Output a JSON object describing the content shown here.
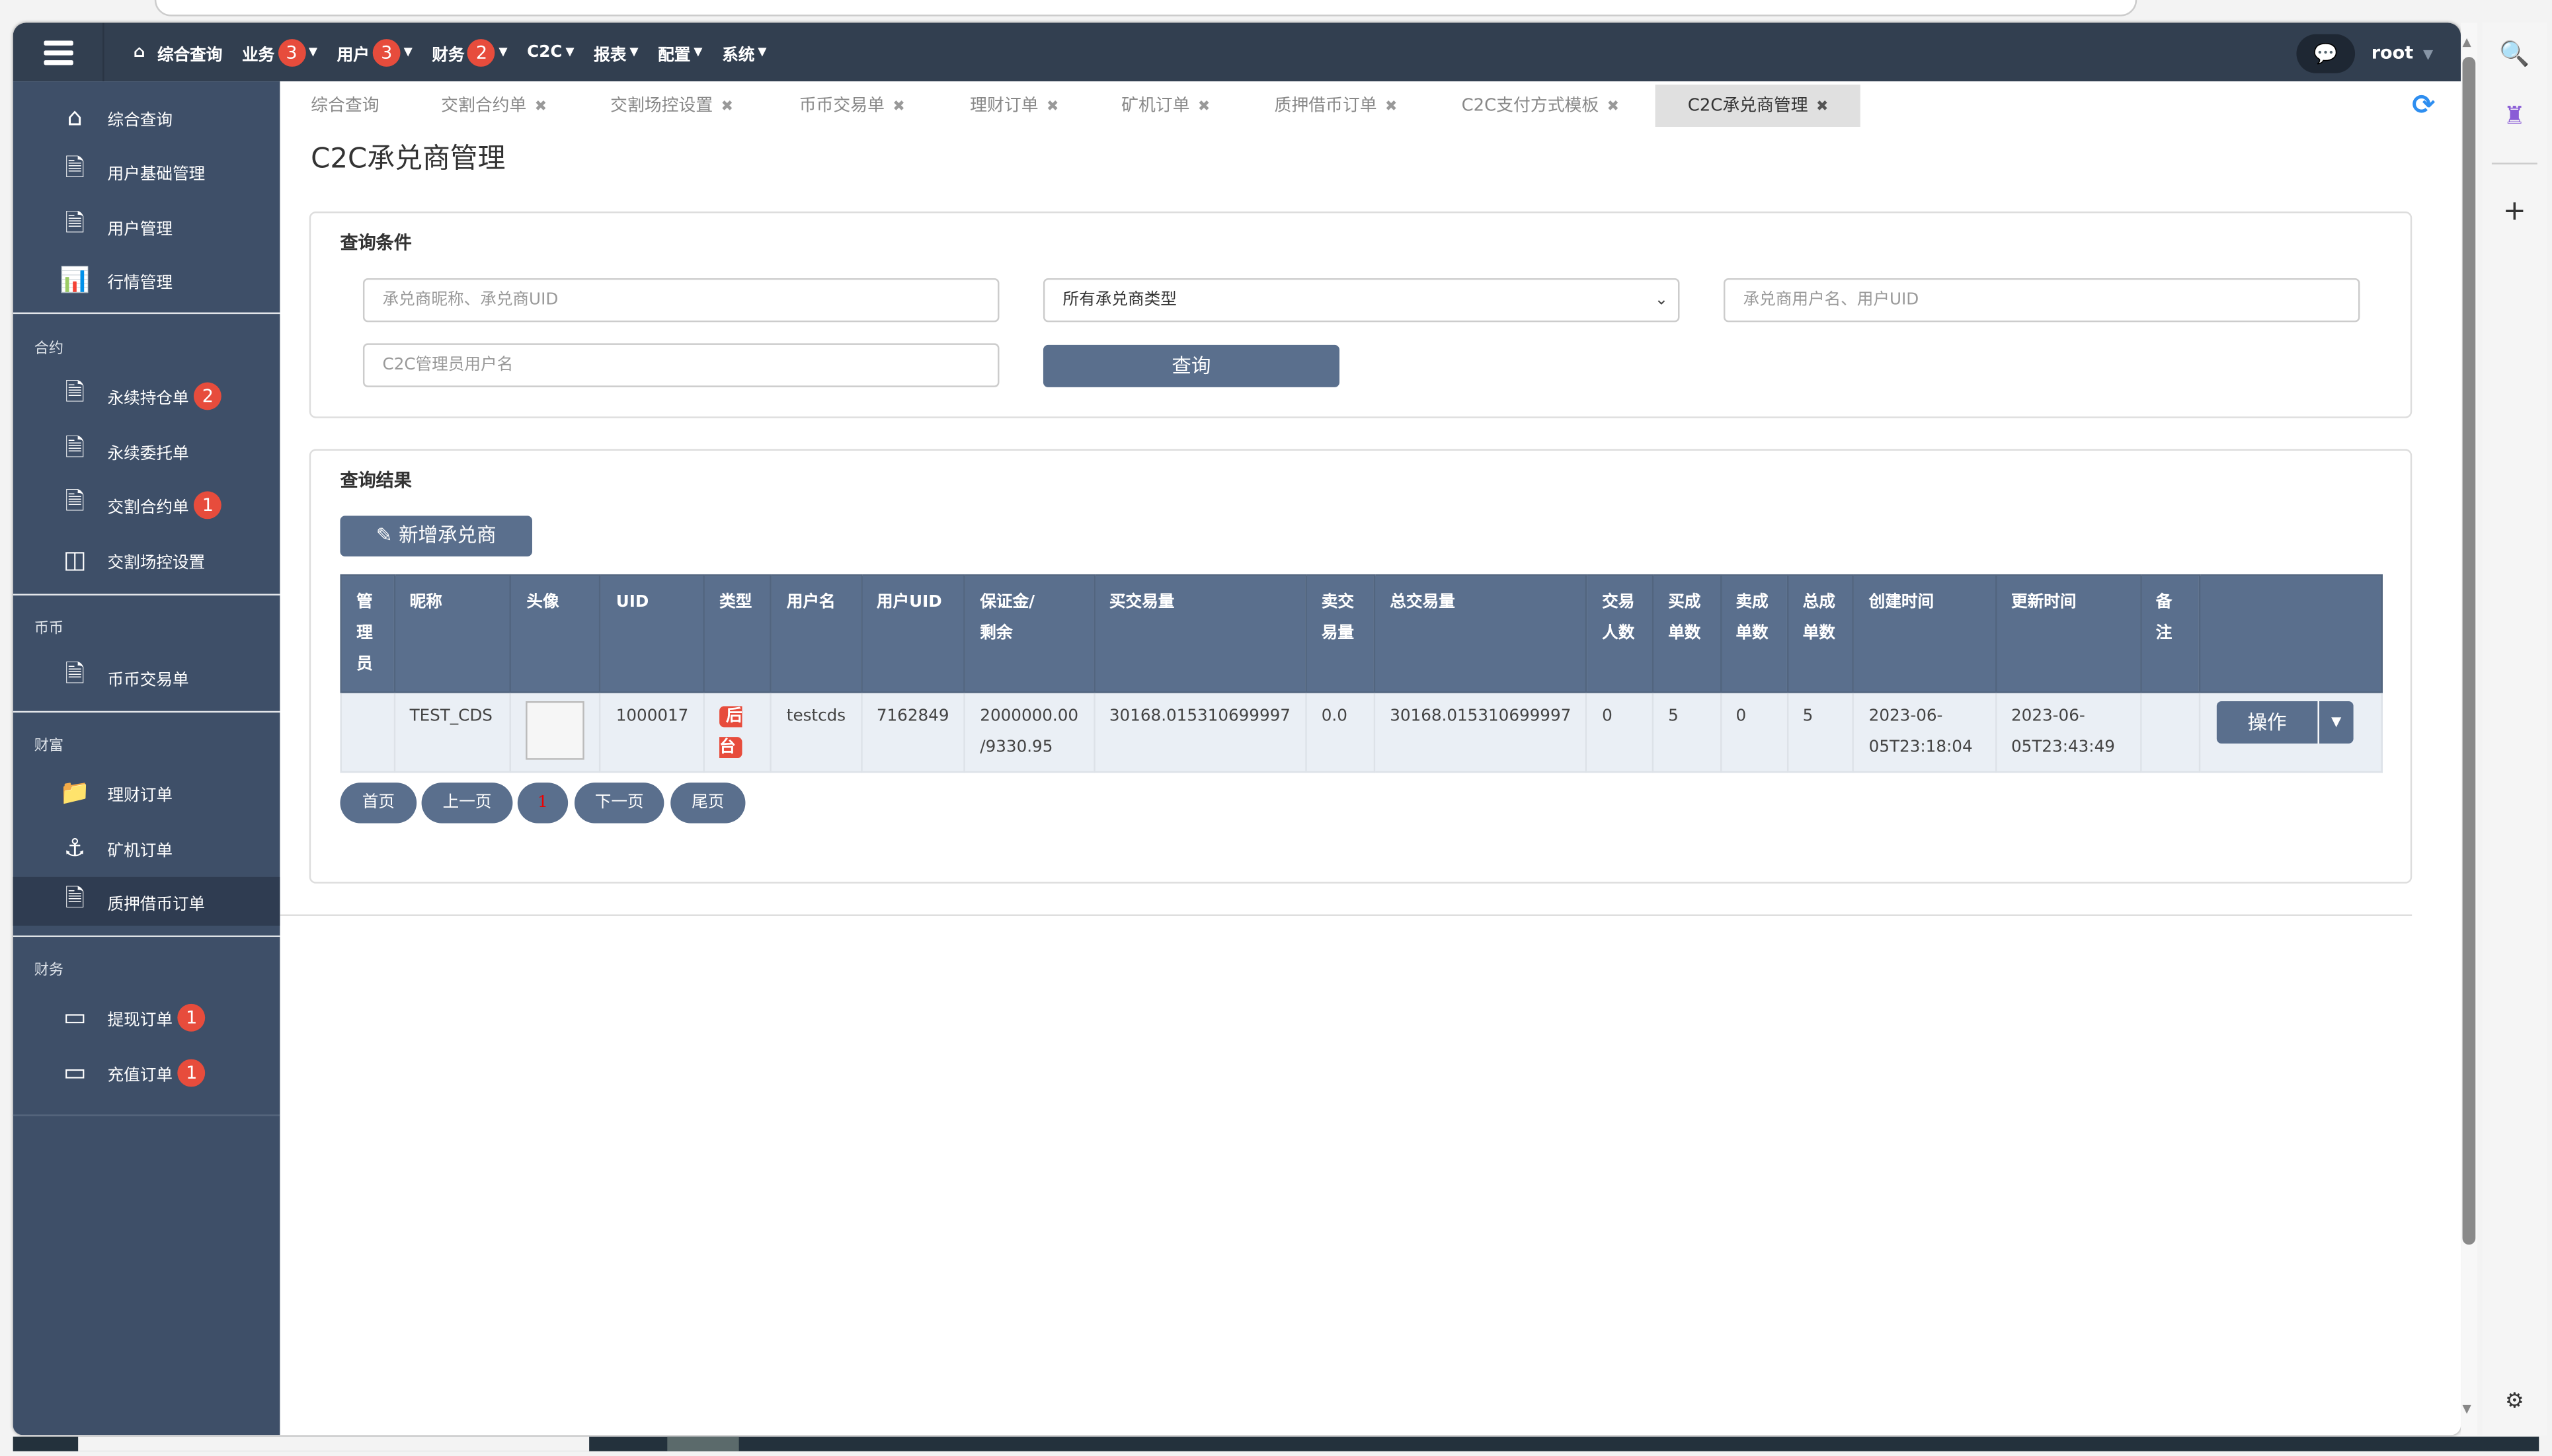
{
  "navbar": {
    "menu": [
      {
        "label": "综合查询",
        "icon": "home-icon"
      },
      {
        "label": "业务",
        "badge": "3"
      },
      {
        "label": "用户",
        "badge": "3"
      },
      {
        "label": "财务",
        "badge": "2"
      },
      {
        "label": "C2C"
      },
      {
        "label": "报表"
      },
      {
        "label": "配置"
      },
      {
        "label": "系统"
      }
    ],
    "user": "root"
  },
  "sidebar": {
    "items": [
      {
        "label": "综合查询",
        "icon": "home-icon"
      },
      {
        "label": "用户基础管理",
        "icon": "document-icon"
      },
      {
        "label": "用户管理",
        "icon": "document-icon"
      },
      {
        "label": "行情管理",
        "icon": "bar-chart-icon"
      }
    ],
    "sections": [
      {
        "label": "合约",
        "items": [
          {
            "label": "永续持仓单",
            "badge": "2"
          },
          {
            "label": "永续委托单"
          },
          {
            "label": "交割合约单",
            "badge": "1"
          },
          {
            "label": "交割场控设置"
          }
        ]
      },
      {
        "label": "币币",
        "items": [
          {
            "label": "币币交易单"
          }
        ]
      },
      {
        "label": "财富",
        "items": [
          {
            "label": "理财订单"
          },
          {
            "label": "矿机订单"
          },
          {
            "label": "质押借币订单"
          }
        ]
      },
      {
        "label": "财务",
        "items": [
          {
            "label": "提现订单",
            "badge": "1"
          },
          {
            "label": "充值订单",
            "badge": "1"
          }
        ]
      }
    ]
  },
  "tabs": [
    "综合查询",
    "交割合约单",
    "交割场控设置",
    "币币交易单",
    "理财订单",
    "矿机订单",
    "质押借币订单",
    "C2C支付方式模板",
    "C2C承兑商管理"
  ],
  "page_title": "C2C承兑商管理",
  "query": {
    "title": "查询条件",
    "nickname_placeholder": "承兑商昵称、承兑商UID",
    "type_select": "所有承兑商类型",
    "username_placeholder": "承兑商用户名、用户UID",
    "admin_placeholder": "C2C管理员用户名",
    "submit": "查询"
  },
  "results": {
    "title": "查询结果",
    "add_button": "新增承兑商",
    "headers": [
      "管理员",
      "昵称",
      "头像",
      "UID",
      "类型",
      "用户名",
      "用户UID",
      "保证金/剩余",
      "买交易量",
      "卖交易量",
      "总交易量",
      "交易人数",
      "买成单数",
      "卖成单数",
      "总成单数",
      "创建时间",
      "更新时间",
      "备注",
      ""
    ],
    "header_lines": [
      [
        "管",
        "理",
        "员"
      ],
      [
        "昵称"
      ],
      [
        "头像"
      ],
      [
        "UID"
      ],
      [
        "类型"
      ],
      [
        "用户名"
      ],
      [
        "用户UID"
      ],
      [
        "保证金",
        "/剩余"
      ],
      [
        "买交易量"
      ],
      [
        "卖交",
        "易量"
      ],
      [
        "总交易量"
      ],
      [
        "交易",
        "人数"
      ],
      [
        "买成",
        "单数"
      ],
      [
        "卖成",
        "单数"
      ],
      [
        "总成",
        "单数"
      ],
      [
        "创建时间"
      ],
      [
        "更新时间"
      ],
      [
        "备注"
      ],
      []
    ],
    "rows": [
      {
        "admin": "",
        "nickname": "TEST_CDS",
        "uid": "1000017",
        "type": "后台",
        "username": "testcds",
        "user_uid": "7162849",
        "deposit": "2000000.00",
        "remaining": "/9330.95",
        "buy_volume": "30168.015310699997",
        "sell_volume": "0.0",
        "total_volume": "30168.015310699997",
        "traders": "0",
        "buy_orders": "5",
        "sell_orders": "0",
        "total_orders": "5",
        "created_date": "2023-06-",
        "created_time": "05T23:18:04",
        "updated_date": "2023-06-",
        "updated_time": "05T23:43:49",
        "remark": "",
        "action": "操作"
      }
    ]
  },
  "pagination": {
    "first": "首页",
    "prev": "上一页",
    "current": "1",
    "next": "下一页",
    "last": "尾页"
  },
  "colors": {
    "navbar": "#323f50",
    "sidebar": "#3e4f68",
    "primary": "#5a6f8d",
    "badge": "#e74c3c",
    "refresh": "#2e8ef0"
  }
}
